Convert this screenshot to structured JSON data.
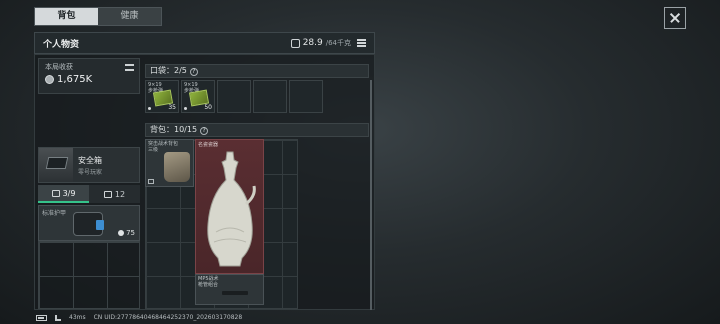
{
  "tabs": [
    {
      "label": "背包",
      "active": true
    },
    {
      "label": "健康",
      "active": false
    }
  ],
  "header": {
    "title": "个人物资",
    "weight": "28.9",
    "weight_capacity": "/64千克"
  },
  "earnings": {
    "label": "本局收获",
    "value": "1,675K"
  },
  "safe_box": {
    "name": "安全箱",
    "subtitle": "零号玩家"
  },
  "container_tabs": [
    {
      "label": "3/9",
      "icon": "briefcase-icon",
      "active": true
    },
    {
      "label": "12",
      "icon": "tag-icon",
      "active": false
    }
  ],
  "armor": {
    "label": "标准护甲",
    "durability": "75"
  },
  "pocket": {
    "label": "口袋：2/5",
    "items": [
      {
        "label": "9×19\n步枪弹",
        "count": "35"
      },
      {
        "label": "9×19\n步枪弹",
        "count": "50"
      }
    ]
  },
  "backpack": {
    "label": "背包：10/15",
    "items": [
      {
        "name": "tool",
        "label": "突击战术背包\n三级"
      },
      {
        "name": "vase",
        "label": "名瓷瓷器"
      },
      {
        "name": "rifle",
        "label": "MP5战术\n枪管组合"
      }
    ]
  },
  "status_bar": {
    "ping": "43ms",
    "uid": "CN UID:27778640468464252370_202603170828"
  },
  "colors": {
    "accent": "#35c28a",
    "active_tab_bg": "#d5d9db",
    "rare_item_bg": "#5a2e32"
  }
}
